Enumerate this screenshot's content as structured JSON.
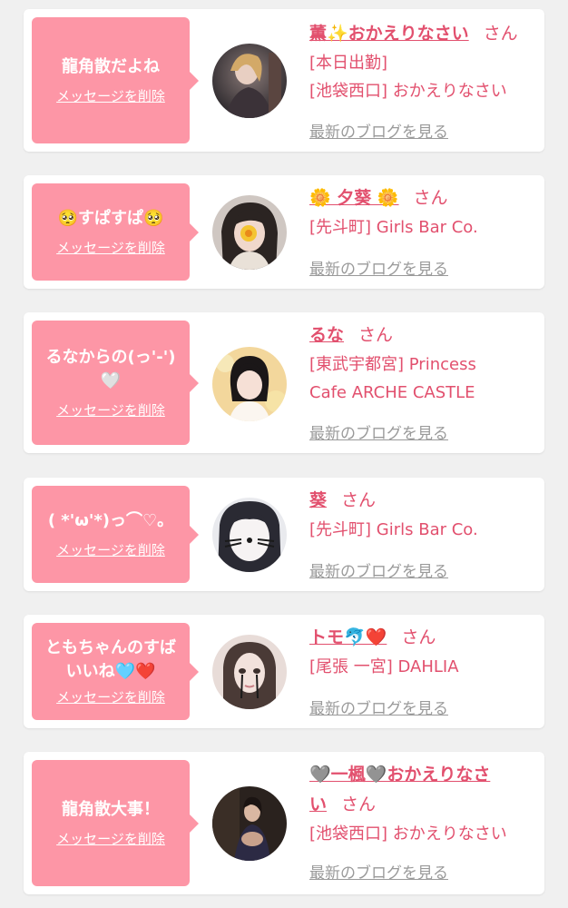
{
  "delete_label": "メッセージを削除",
  "blog_label": "最新のブログを見る",
  "honorific": "さん",
  "cards": [
    {
      "message": "龍角散だよね",
      "cast_name": "薫✨おかえりなさい",
      "shop": "[本日出勤]",
      "shop2": "[池袋西口] おかえりなさい"
    },
    {
      "message": "🥺すぱすぱ🥺",
      "cast_name": "🌼 夕葵 🌼",
      "shop": "[先斗町] Girls Bar Co."
    },
    {
      "message": "るなからの(っ'-')",
      "message2": "🤍",
      "cast_name": "るな",
      "shop": "[東武宇都宮] Princess",
      "shop2": "Cafe ARCHE CASTLE"
    },
    {
      "message": "( *'ω'*)っ⌒♡。",
      "cast_name": "葵",
      "shop": "[先斗町] Girls Bar Co."
    },
    {
      "message": "ともちゃんのすば",
      "message2": "いいね🩵❤️",
      "cast_name": "トモ🐬❤️",
      "shop": "[尾張 一宮] DAHLIA"
    },
    {
      "message": "龍角散大事！",
      "cast_name": "🩶一楓🩶おかえりなさ",
      "cast_name2": "い",
      "shop": "[池袋西口] おかえりなさい"
    }
  ],
  "colors": {
    "page_bg": "#f0f0f0",
    "bubble": "#fd96a6",
    "name_pink": "#e2506e",
    "blog_gray": "#9a9a9a"
  }
}
